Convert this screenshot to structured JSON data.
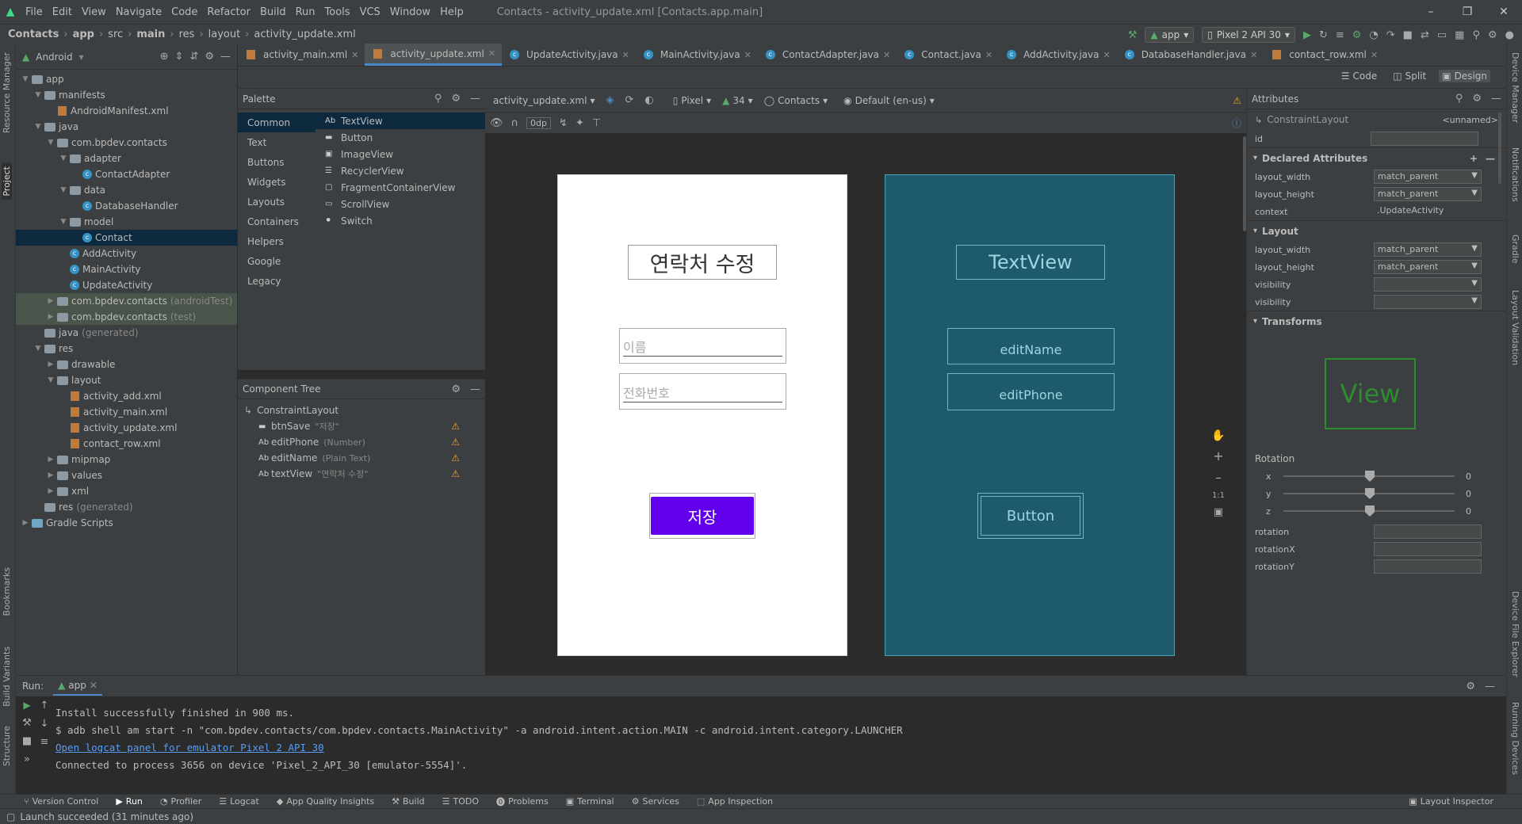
{
  "menubar": {
    "items": [
      "File",
      "Edit",
      "View",
      "Navigate",
      "Code",
      "Refactor",
      "Build",
      "Run",
      "Tools",
      "VCS",
      "Window",
      "Help"
    ],
    "title": "Contacts - activity_update.xml [Contacts.app.main]"
  },
  "breadcrumb": [
    "Contacts",
    "app",
    "src",
    "main",
    "res",
    "layout",
    "activity_update.xml"
  ],
  "toolbar": {
    "config": "app",
    "device": "Pixel 2 API 30"
  },
  "project": {
    "view": "Android",
    "tree": [
      {
        "label": "app",
        "extra": "",
        "depth": 0,
        "icon": "folder",
        "open": true
      },
      {
        "label": "manifests",
        "extra": "",
        "depth": 1,
        "icon": "folder",
        "open": true
      },
      {
        "label": "AndroidManifest.xml",
        "extra": "",
        "depth": 2,
        "icon": "xml",
        "open": null
      },
      {
        "label": "java",
        "extra": "",
        "depth": 1,
        "icon": "folder",
        "open": true
      },
      {
        "label": "com.bpdev.contacts",
        "extra": "",
        "depth": 2,
        "icon": "folder",
        "open": true
      },
      {
        "label": "adapter",
        "extra": "",
        "depth": 3,
        "icon": "folder",
        "open": true
      },
      {
        "label": "ContactAdapter",
        "extra": "",
        "depth": 4,
        "icon": "class",
        "open": null
      },
      {
        "label": "data",
        "extra": "",
        "depth": 3,
        "icon": "folder",
        "open": true
      },
      {
        "label": "DatabaseHandler",
        "extra": "",
        "depth": 4,
        "icon": "class",
        "open": null
      },
      {
        "label": "model",
        "extra": "",
        "depth": 3,
        "icon": "folder",
        "open": true
      },
      {
        "label": "Contact",
        "extra": "",
        "depth": 4,
        "icon": "class",
        "open": null,
        "selected": true
      },
      {
        "label": "AddActivity",
        "extra": "",
        "depth": 3,
        "icon": "class",
        "open": null
      },
      {
        "label": "MainActivity",
        "extra": "",
        "depth": 3,
        "icon": "class",
        "open": null
      },
      {
        "label": "UpdateActivity",
        "extra": "",
        "depth": 3,
        "icon": "class",
        "open": null
      },
      {
        "label": "com.bpdev.contacts",
        "extra": "(androidTest)",
        "depth": 2,
        "icon": "folder",
        "open": false,
        "hl": true
      },
      {
        "label": "com.bpdev.contacts",
        "extra": "(test)",
        "depth": 2,
        "icon": "folder",
        "open": false,
        "hl": true
      },
      {
        "label": "java",
        "extra": "(generated)",
        "depth": 1,
        "icon": "folder",
        "open": null
      },
      {
        "label": "res",
        "extra": "",
        "depth": 1,
        "icon": "folder",
        "open": true
      },
      {
        "label": "drawable",
        "extra": "",
        "depth": 2,
        "icon": "folder",
        "open": false
      },
      {
        "label": "layout",
        "extra": "",
        "depth": 2,
        "icon": "folder",
        "open": true
      },
      {
        "label": "activity_add.xml",
        "extra": "",
        "depth": 3,
        "icon": "xml",
        "open": null
      },
      {
        "label": "activity_main.xml",
        "extra": "",
        "depth": 3,
        "icon": "xml",
        "open": null
      },
      {
        "label": "activity_update.xml",
        "extra": "",
        "depth": 3,
        "icon": "xml",
        "open": null
      },
      {
        "label": "contact_row.xml",
        "extra": "",
        "depth": 3,
        "icon": "xml",
        "open": null
      },
      {
        "label": "mipmap",
        "extra": "",
        "depth": 2,
        "icon": "folder",
        "open": false
      },
      {
        "label": "values",
        "extra": "",
        "depth": 2,
        "icon": "folder",
        "open": false
      },
      {
        "label": "xml",
        "extra": "",
        "depth": 2,
        "icon": "folder",
        "open": false
      },
      {
        "label": "res",
        "extra": "(generated)",
        "depth": 1,
        "icon": "folder",
        "open": null
      },
      {
        "label": "Gradle Scripts",
        "extra": "",
        "depth": 0,
        "icon": "gradle",
        "open": false
      }
    ]
  },
  "tabs": [
    {
      "label": "activity_main.xml",
      "icon": "xml"
    },
    {
      "label": "activity_update.xml",
      "icon": "xml",
      "active": true
    },
    {
      "label": "UpdateActivity.java",
      "icon": "class"
    },
    {
      "label": "MainActivity.java",
      "icon": "class"
    },
    {
      "label": "ContactAdapter.java",
      "icon": "class"
    },
    {
      "label": "Contact.java",
      "icon": "class"
    },
    {
      "label": "AddActivity.java",
      "icon": "class"
    },
    {
      "label": "DatabaseHandler.java",
      "icon": "class"
    },
    {
      "label": "contact_row.xml",
      "icon": "xml"
    }
  ],
  "viewmodes": [
    "Code",
    "Split",
    "Design"
  ],
  "palette": {
    "title": "Palette",
    "categories": [
      "Common",
      "Text",
      "Buttons",
      "Widgets",
      "Layouts",
      "Containers",
      "Helpers",
      "Google",
      "Legacy"
    ],
    "items": [
      {
        "icon": "Ab",
        "label": "TextView"
      },
      {
        "icon": "btn",
        "label": "Button"
      },
      {
        "icon": "img",
        "label": "ImageView"
      },
      {
        "icon": "list",
        "label": "RecyclerView"
      },
      {
        "icon": "frag",
        "label": "FragmentContainerView"
      },
      {
        "icon": "scroll",
        "label": "ScrollView"
      },
      {
        "icon": "switch",
        "label": "Switch"
      }
    ]
  },
  "componentTree": {
    "title": "Component Tree",
    "root": "ConstraintLayout",
    "children": [
      {
        "icon": "btn",
        "name": "btnSave",
        "detail": "\"저장\""
      },
      {
        "icon": "Ab",
        "name": "editPhone",
        "detail": "(Number)"
      },
      {
        "icon": "Ab",
        "name": "editName",
        "detail": "(Plain Text)"
      },
      {
        "icon": "Ab",
        "name": "textView",
        "detail": "\"연락처 수정\""
      }
    ]
  },
  "designToolbar": {
    "file": "activity_update.xml",
    "device": "Pixel",
    "api": "34",
    "theme": "Contacts",
    "locale": "Default (en-us)",
    "margin": "0dp"
  },
  "preview": {
    "title": "연락처 수정",
    "namePlaceholder": "이름",
    "phonePlaceholder": "전화번호",
    "saveButton": "저장",
    "buttonColor": "#6200ee"
  },
  "blueprint": {
    "textview": "TextView",
    "editName": "editName",
    "editPhone": "editPhone",
    "button": "Button"
  },
  "zoomControls": [
    "1:1"
  ],
  "attributes": {
    "title": "Attributes",
    "component": "ConstraintLayout",
    "unnamed": "<unnamed>",
    "idLabel": "id",
    "declaredTitle": "Declared Attributes",
    "declared": [
      {
        "name": "layout_width",
        "value": "match_parent"
      },
      {
        "name": "layout_height",
        "value": "match_parent"
      },
      {
        "name": "context",
        "value": ".UpdateActivity"
      }
    ],
    "layoutTitle": "Layout",
    "layout": [
      {
        "name": "layout_width",
        "value": "match_parent"
      },
      {
        "name": "layout_height",
        "value": "match_parent"
      },
      {
        "name": "visibility",
        "value": ""
      },
      {
        "name": "visibility",
        "value": ""
      }
    ],
    "transformsTitle": "Transforms",
    "viewLabel": "View",
    "rotationTitle": "Rotation",
    "sliders": [
      {
        "axis": "x",
        "value": "0"
      },
      {
        "axis": "y",
        "value": "0"
      },
      {
        "axis": "z",
        "value": "0"
      }
    ],
    "rotationFields": [
      "rotation",
      "rotationX",
      "rotationY"
    ]
  },
  "run": {
    "label": "Run:",
    "config": "app",
    "lines": [
      "Install successfully finished in 900 ms.",
      "$ adb shell am start -n \"com.bpdev.contacts/com.bpdev.contacts.MainActivity\" -a android.intent.action.MAIN -c android.intent.category.LAUNCHER",
      "Open logcat panel for emulator Pixel 2 API 30",
      "Connected to process 3656 on device 'Pixel_2_API_30 [emulator-5554]'."
    ]
  },
  "bottomTools": [
    "Version Control",
    "Run",
    "Profiler",
    "Logcat",
    "App Quality Insights",
    "Build",
    "TODO",
    "Problems",
    "Terminal",
    "Services",
    "App Inspection"
  ],
  "layoutInspector": "Layout Inspector",
  "status": "Launch succeeded (31 minutes ago)",
  "leftTabs": [
    "Resource Manager",
    "Project",
    "Bookmarks",
    "Build Variants",
    "Structure"
  ],
  "rightTabs": [
    "Device Manager",
    "Notifications",
    "Gradle",
    "Layout Validation",
    "Device File Explorer",
    "Running Devices"
  ]
}
